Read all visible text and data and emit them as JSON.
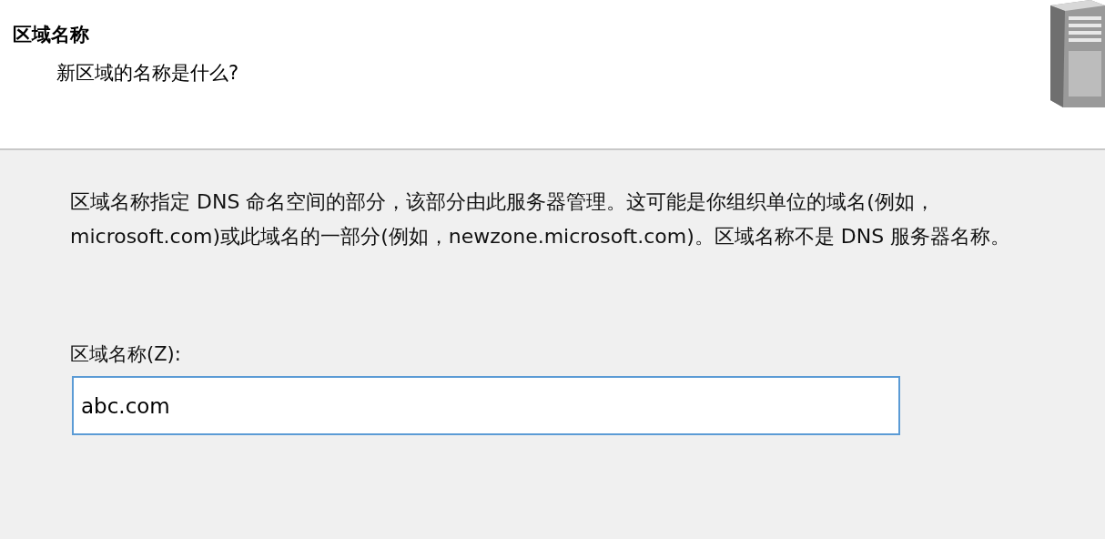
{
  "header": {
    "title": "区域名称",
    "subtitle": "新区域的名称是什么?"
  },
  "description": "区域名称指定 DNS 命名空间的部分，该部分由此服务器管理。这可能是你组织单位的域名(例如，microsoft.com)或此域名的一部分(例如，newzone.microsoft.com)。区域名称不是 DNS 服务器名称。",
  "zone_name_field": {
    "label": "区域名称(Z):",
    "value": "abc.com",
    "focused": true
  }
}
